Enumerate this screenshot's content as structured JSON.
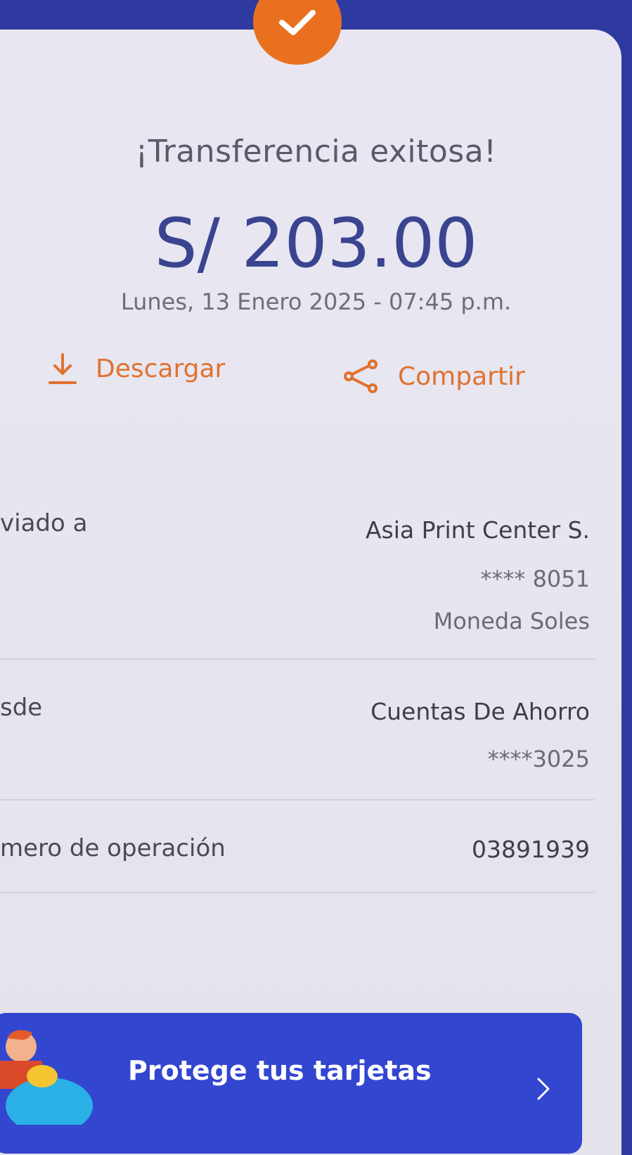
{
  "header": {
    "title": "¡Transferencia exitosa!",
    "amount": "S/ 203.00",
    "datetime": "Lunes, 13 Enero 2025 - 07:45 p.m."
  },
  "actions": {
    "download_label": "Descargar",
    "share_label": "Compartir"
  },
  "details": {
    "sent_to": {
      "label": "viado a",
      "name": "Asia Print Center S.",
      "account": "**** 8051",
      "currency": "Moneda Soles"
    },
    "from": {
      "label": "sde",
      "account_type": "Cuentas De Ahorro",
      "account": "****3025"
    },
    "operation": {
      "label": "mero de operación",
      "number": "03891939"
    }
  },
  "promo": {
    "label": "Protege tus tarjetas"
  },
  "colors": {
    "accent": "#e8701f",
    "primary": "#3a4490",
    "promo_bg": "#3346d0"
  },
  "icons": [
    "check-icon",
    "download-icon",
    "share-icon",
    "chevron-right-icon",
    "superhero-illustration"
  ]
}
